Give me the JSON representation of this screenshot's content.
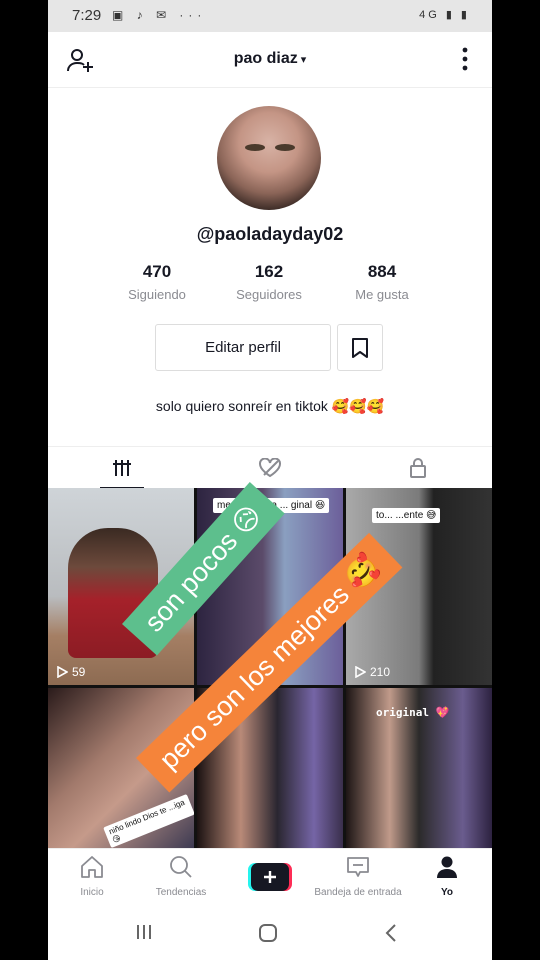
{
  "status_bar": {
    "time": "7:29",
    "left_icons": "▣ ♪ ✉ ···",
    "right_icons": "4G ▮ ▮"
  },
  "header": {
    "title": "pao diaz",
    "caret": "▾"
  },
  "profile": {
    "username": "@paoladayday02",
    "stats": [
      {
        "value": "470",
        "label": "Siguiendo"
      },
      {
        "value": "162",
        "label": "Seguidores"
      },
      {
        "value": "884",
        "label": "Me gusta"
      }
    ],
    "edit_button": "Editar perfil",
    "bio": "solo quiero sonreír en tiktok 🥰🥰🥰"
  },
  "videos": [
    {
      "views": "59",
      "caption": ""
    },
    {
      "views": "",
      "caption": "me ... sonrisa ... ginal 😆"
    },
    {
      "views": "210",
      "caption": "to... ...ente 😅"
    },
    {
      "views": "",
      "caption": "niño lindo Dios te ...iga 😘"
    },
    {
      "views": "",
      "caption": ""
    },
    {
      "views": "",
      "caption": "original 💖"
    }
  ],
  "overlays": {
    "banner1": "son pocos 😥",
    "banner2": "pero son los mejores 🥰"
  },
  "bottom_nav": [
    {
      "label": "Inicio"
    },
    {
      "label": "Tendencias"
    },
    {
      "label": "Bandeja de entrada"
    },
    {
      "label": "Yo"
    }
  ],
  "colors": {
    "accent_text": "#161823",
    "muted": "#8a8b91",
    "banner_green": "#5dbf8d",
    "banner_orange": "#f5843a",
    "tiktok_cyan": "#25f4ee",
    "tiktok_red": "#fe2c55"
  }
}
